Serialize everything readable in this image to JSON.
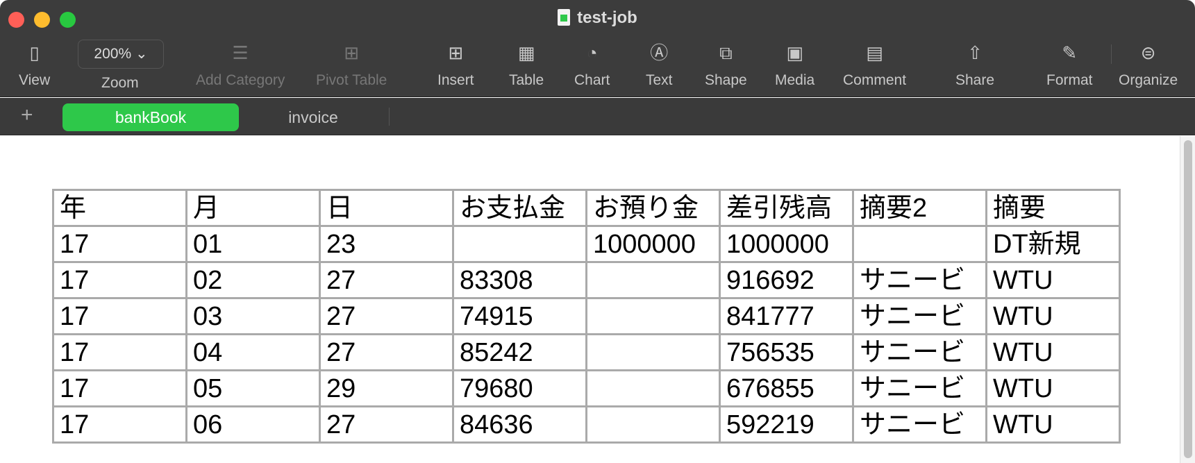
{
  "window": {
    "title": "test-job",
    "traffic_lights": {
      "close": "#ff5f57",
      "minimize": "#febc2e",
      "zoom": "#28c840"
    }
  },
  "toolbar": {
    "view": "View",
    "zoom_value": "200%",
    "zoom": "Zoom",
    "add_category": "Add Category",
    "pivot_table": "Pivot Table",
    "insert": "Insert",
    "table": "Table",
    "chart": "Chart",
    "text": "Text",
    "shape": "Shape",
    "media": "Media",
    "comment": "Comment",
    "share": "Share",
    "format": "Format",
    "organize": "Organize"
  },
  "sheets": {
    "add": "+",
    "tabs": [
      {
        "label": "bankBook",
        "active": true
      },
      {
        "label": "invoice",
        "active": false
      }
    ],
    "accent": "#2ec84a"
  },
  "table": {
    "headers": [
      "年",
      "月",
      "日",
      "お支払金",
      "お預り金",
      "差引残高",
      "摘要2",
      "摘要"
    ],
    "rows": [
      [
        "17",
        "01",
        "23",
        "",
        "1000000",
        "1000000",
        "",
        "DT新規"
      ],
      [
        "17",
        "02",
        "27",
        "83308",
        "",
        "916692",
        "サニービ",
        "WTU"
      ],
      [
        "17",
        "03",
        "27",
        "74915",
        "",
        "841777",
        "サニービ",
        "WTU"
      ],
      [
        "17",
        "04",
        "27",
        "85242",
        "",
        "756535",
        "サニービ",
        "WTU"
      ],
      [
        "17",
        "05",
        "29",
        "79680",
        "",
        "676855",
        "サニービ",
        "WTU"
      ],
      [
        "17",
        "06",
        "27",
        "84636",
        "",
        "592219",
        "サニービ",
        "WTU"
      ]
    ]
  }
}
